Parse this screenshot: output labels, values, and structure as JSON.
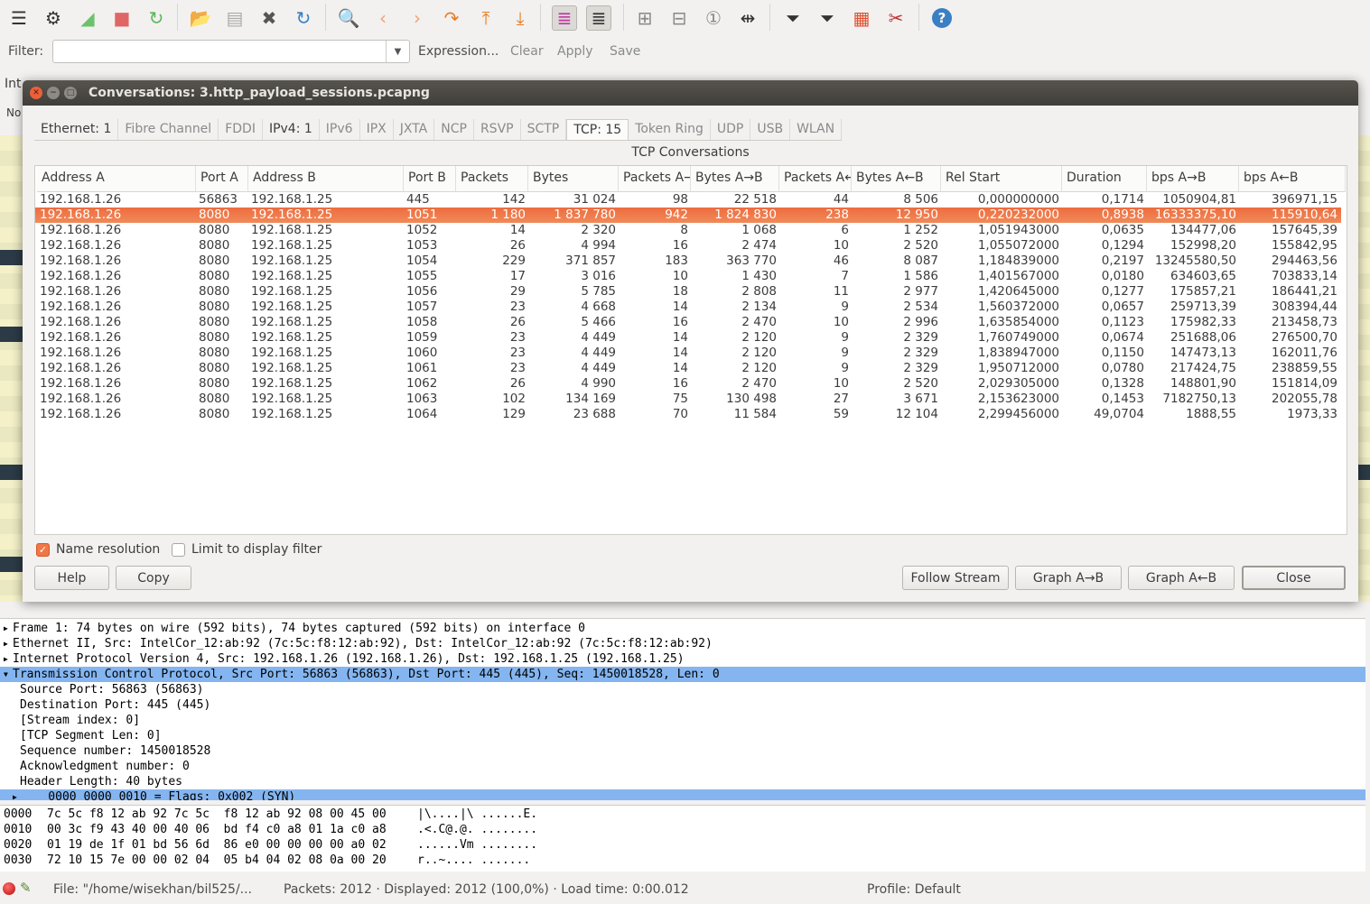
{
  "toolbar": {
    "icons": [
      "interfaces-icon",
      "capture-options-icon",
      "start-capture-icon",
      "stop-capture-icon",
      "restart-capture-icon",
      "open-file-icon",
      "file-set-icon",
      "close-file-icon",
      "reload-icon",
      "find-icon",
      "go-back-icon",
      "go-forward-icon",
      "go-to-packet-icon",
      "first-packet-icon",
      "last-packet-icon",
      "colorize-icon",
      "auto-scroll-icon",
      "zoom-in-icon",
      "zoom-out-icon",
      "normal-size-icon",
      "resize-columns-icon",
      "capture-filters-icon",
      "display-filters-icon",
      "coloring-rules-icon",
      "preferences-icon",
      "help-icon"
    ]
  },
  "filterbar": {
    "label": "Filter:",
    "value": "",
    "expression": "Expression...",
    "clear": "Clear",
    "apply": "Apply",
    "save": "Save"
  },
  "background": {
    "interface_label": "Int",
    "no_label": "No"
  },
  "dialog": {
    "title": "Conversations: 3.http_payload_sessions.pcapng",
    "tabs": [
      {
        "label": "Ethernet: 1",
        "has_data": true
      },
      {
        "label": "Fibre Channel",
        "has_data": false
      },
      {
        "label": "FDDI",
        "has_data": false
      },
      {
        "label": "IPv4: 1",
        "has_data": true
      },
      {
        "label": "IPv6",
        "has_data": false
      },
      {
        "label": "IPX",
        "has_data": false
      },
      {
        "label": "JXTA",
        "has_data": false
      },
      {
        "label": "NCP",
        "has_data": false
      },
      {
        "label": "RSVP",
        "has_data": false
      },
      {
        "label": "SCTP",
        "has_data": false
      },
      {
        "label": "TCP: 15",
        "has_data": true,
        "selected": true
      },
      {
        "label": "Token Ring",
        "has_data": false
      },
      {
        "label": "UDP",
        "has_data": false
      },
      {
        "label": "USB",
        "has_data": false
      },
      {
        "label": "WLAN",
        "has_data": false
      }
    ],
    "section_title": "TCP Conversations",
    "columns": [
      "Address A",
      "Port A",
      "Address B",
      "Port B",
      "Packets",
      "Bytes",
      "Packets A→B",
      "Bytes A→B",
      "Packets A←B",
      "Bytes A←B",
      "Rel Start",
      "Duration",
      "bps A→B",
      "bps A←B"
    ],
    "selected_row": 1,
    "rows": [
      [
        "192.168.1.26",
        "56863",
        "192.168.1.25",
        "445",
        "142",
        "31 024",
        "98",
        "22 518",
        "44",
        "8 506",
        "0,000000000",
        "0,1714",
        "1050904,81",
        "396971,15"
      ],
      [
        "192.168.1.26",
        "8080",
        "192.168.1.25",
        "1051",
        "1 180",
        "1 837 780",
        "942",
        "1 824 830",
        "238",
        "12 950",
        "0,220232000",
        "0,8938",
        "16333375,10",
        "115910,64"
      ],
      [
        "192.168.1.26",
        "8080",
        "192.168.1.25",
        "1052",
        "14",
        "2 320",
        "8",
        "1 068",
        "6",
        "1 252",
        "1,051943000",
        "0,0635",
        "134477,06",
        "157645,39"
      ],
      [
        "192.168.1.26",
        "8080",
        "192.168.1.25",
        "1053",
        "26",
        "4 994",
        "16",
        "2 474",
        "10",
        "2 520",
        "1,055072000",
        "0,1294",
        "152998,20",
        "155842,95"
      ],
      [
        "192.168.1.26",
        "8080",
        "192.168.1.25",
        "1054",
        "229",
        "371 857",
        "183",
        "363 770",
        "46",
        "8 087",
        "1,184839000",
        "0,2197",
        "13245580,50",
        "294463,56"
      ],
      [
        "192.168.1.26",
        "8080",
        "192.168.1.25",
        "1055",
        "17",
        "3 016",
        "10",
        "1 430",
        "7",
        "1 586",
        "1,401567000",
        "0,0180",
        "634603,65",
        "703833,14"
      ],
      [
        "192.168.1.26",
        "8080",
        "192.168.1.25",
        "1056",
        "29",
        "5 785",
        "18",
        "2 808",
        "11",
        "2 977",
        "1,420645000",
        "0,1277",
        "175857,21",
        "186441,21"
      ],
      [
        "192.168.1.26",
        "8080",
        "192.168.1.25",
        "1057",
        "23",
        "4 668",
        "14",
        "2 134",
        "9",
        "2 534",
        "1,560372000",
        "0,0657",
        "259713,39",
        "308394,44"
      ],
      [
        "192.168.1.26",
        "8080",
        "192.168.1.25",
        "1058",
        "26",
        "5 466",
        "16",
        "2 470",
        "10",
        "2 996",
        "1,635854000",
        "0,1123",
        "175982,33",
        "213458,73"
      ],
      [
        "192.168.1.26",
        "8080",
        "192.168.1.25",
        "1059",
        "23",
        "4 449",
        "14",
        "2 120",
        "9",
        "2 329",
        "1,760749000",
        "0,0674",
        "251688,06",
        "276500,70"
      ],
      [
        "192.168.1.26",
        "8080",
        "192.168.1.25",
        "1060",
        "23",
        "4 449",
        "14",
        "2 120",
        "9",
        "2 329",
        "1,838947000",
        "0,1150",
        "147473,13",
        "162011,76"
      ],
      [
        "192.168.1.26",
        "8080",
        "192.168.1.25",
        "1061",
        "23",
        "4 449",
        "14",
        "2 120",
        "9",
        "2 329",
        "1,950712000",
        "0,0780",
        "217424,75",
        "238859,55"
      ],
      [
        "192.168.1.26",
        "8080",
        "192.168.1.25",
        "1062",
        "26",
        "4 990",
        "16",
        "2 470",
        "10",
        "2 520",
        "2,029305000",
        "0,1328",
        "148801,90",
        "151814,09"
      ],
      [
        "192.168.1.26",
        "8080",
        "192.168.1.25",
        "1063",
        "102",
        "134 169",
        "75",
        "130 498",
        "27",
        "3 671",
        "2,153623000",
        "0,1453",
        "7182750,13",
        "202055,78"
      ],
      [
        "192.168.1.26",
        "8080",
        "192.168.1.25",
        "1064",
        "129",
        "23 688",
        "70",
        "11 584",
        "59",
        "12 104",
        "2,299456000",
        "49,0704",
        "1888,55",
        "1973,33"
      ]
    ],
    "name_resolution": {
      "label": "Name resolution",
      "checked": true
    },
    "limit_filter": {
      "label": "Limit to display filter",
      "checked": false
    },
    "buttons": {
      "help": "Help",
      "copy": "Copy",
      "follow_stream": "Follow Stream",
      "graph_ab": "Graph A→B",
      "graph_ba": "Graph A←B",
      "close": "Close"
    }
  },
  "details": [
    {
      "text": "Frame 1: 74 bytes on wire (592 bits), 74 bytes captured (592 bits) on interface 0",
      "expander": "collapsed"
    },
    {
      "text": "Ethernet II, Src: IntelCor_12:ab:92 (7c:5c:f8:12:ab:92), Dst: IntelCor_12:ab:92 (7c:5c:f8:12:ab:92)",
      "expander": "collapsed"
    },
    {
      "text": "Internet Protocol Version 4, Src: 192.168.1.26 (192.168.1.26), Dst: 192.168.1.25 (192.168.1.25)",
      "expander": "collapsed"
    },
    {
      "text": "Transmission Control Protocol, Src Port: 56863 (56863), Dst Port: 445 (445), Seq: 1450018528, Len: 0",
      "expander": "expanded",
      "selected": true
    },
    {
      "text": "Source Port: 56863 (56863)",
      "indent": 1
    },
    {
      "text": "Destination Port: 445 (445)",
      "indent": 1
    },
    {
      "text": "[Stream index: 0]",
      "indent": 1
    },
    {
      "text": "[TCP Segment Len: 0]",
      "indent": 1
    },
    {
      "text": "Sequence number: 1450018528",
      "indent": 1
    },
    {
      "text": "Acknowledgment number: 0",
      "indent": 1
    },
    {
      "text": "Header Length: 40 bytes",
      "indent": 1
    },
    {
      "text": "    0000 0000 0010 = Flags: 0x002 (SYN)",
      "indent": 1,
      "expander": "collapsed",
      "selected": true
    }
  ],
  "hex": [
    {
      "offset": "0000",
      "bytes": "7c 5c f8 12 ab 92 7c 5c  f8 12 ab 92 08 00 45 00",
      "ascii": "|\\....|\\ ......E."
    },
    {
      "offset": "0010",
      "bytes": "00 3c f9 43 40 00 40 06  bd f4 c0 a8 01 1a c0 a8",
      "ascii": ".<.C@.@. ........"
    },
    {
      "offset": "0020",
      "bytes": "01 19 de 1f 01 bd 56 6d  86 e0 00 00 00 00 a0 02",
      "ascii": "......Vm ........"
    },
    {
      "offset": "0030",
      "bytes": "72 10 15 7e 00 00 02 04  05 b4 04 02 08 0a 00 20",
      "ascii": "r..~.... ......."
    }
  ],
  "statusbar": {
    "file": "File: \"/home/wisekhan/bil525/...",
    "packets": "Packets: 2012 · Displayed: 2012 (100,0%) · Load time: 0:00.012",
    "profile": "Profile: Default"
  },
  "colors": {
    "selection_row": "#ef7443",
    "detail_selection": "#84b5f0",
    "titlebar": "#4a4843",
    "packet_list_bg": "#f4f1c9"
  }
}
